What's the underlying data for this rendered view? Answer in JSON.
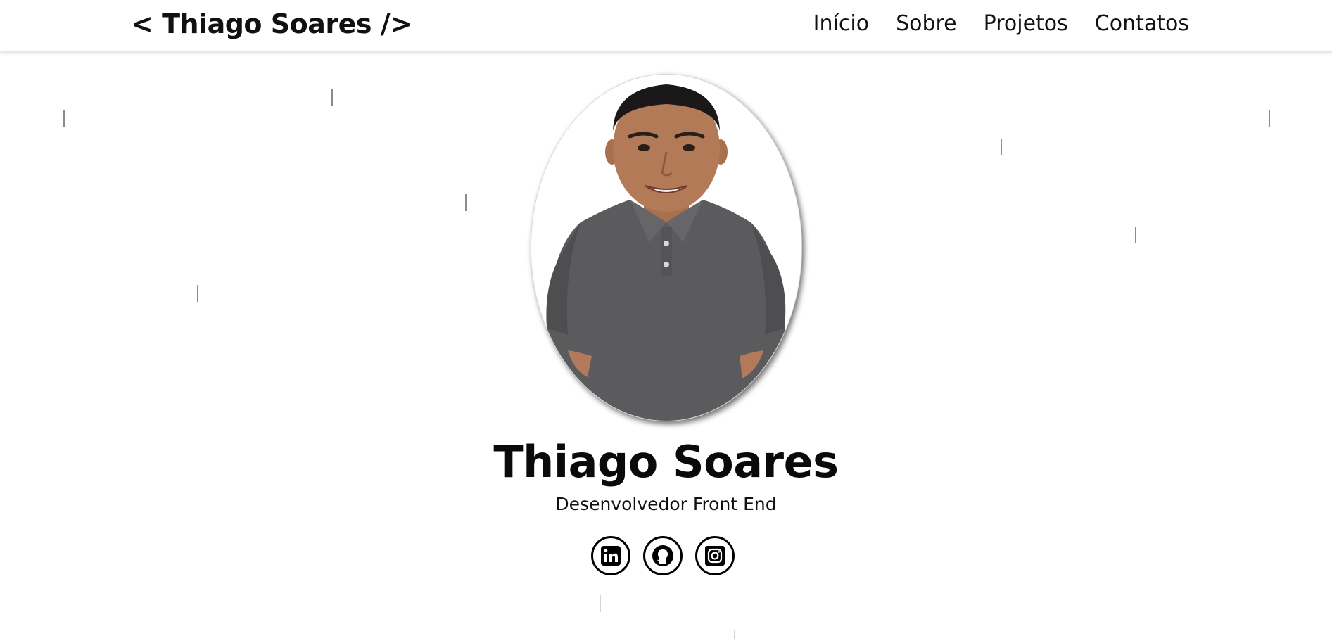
{
  "header": {
    "brand": "< Thiago Soares />",
    "nav": [
      {
        "label": "Início"
      },
      {
        "label": "Sobre"
      },
      {
        "label": "Projetos"
      },
      {
        "label": "Contatos"
      }
    ]
  },
  "hero": {
    "name": "Thiago Soares",
    "role": "Desenvolvedor Front End",
    "socials": [
      {
        "icon": "linkedin-icon"
      },
      {
        "icon": "github-icon"
      },
      {
        "icon": "instagram-icon"
      }
    ]
  },
  "colors": {
    "text": "#000000",
    "background": "#ffffff",
    "streak": "#8c8c8c",
    "shirt": "#5a5a5c"
  }
}
